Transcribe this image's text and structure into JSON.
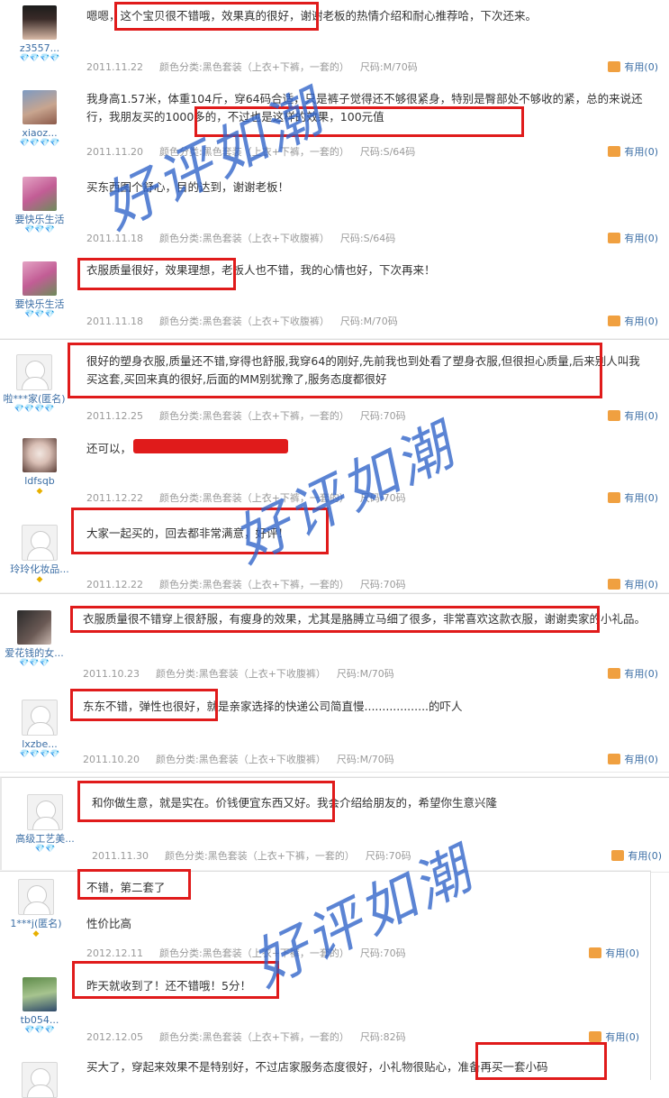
{
  "reviews": [
    {
      "user": "z3557...",
      "rank": "💎💎💎💎",
      "content": "嗯嗯，这个宝贝很不错哦，效果真的很好，谢谢老板的热情介绍和耐心推荐哈，下次还来。",
      "date": "2011.11.22",
      "sku": "颜色分类:黑色套装（上衣+下裤，一套的）",
      "size": "尺码:M/70码",
      "useful": "有用(0)"
    },
    {
      "user": "xiaoz...",
      "rank": "💎💎💎💎",
      "content": "我身高1.57米，体重104斤，穿64码合适，只是裤子觉得还不够很紧身，特别是臀部处不够收的紧，总的来说还行，我朋友买的1000多的，不过也是这样的效果，100元值",
      "date": "2011.11.20",
      "sku": "颜色分类:黑色套装（上衣+下裤，一套的）",
      "size": "尺码:S/64码",
      "useful": "有用(0)"
    },
    {
      "user": "要快乐生活",
      "rank": "💎💎💎",
      "content": "买东西图个舒心，目的达到，谢谢老板！",
      "date": "2011.11.18",
      "sku": "颜色分类:黑色套装（上衣+下收腹裤）",
      "size": "尺码:S/64码",
      "useful": "有用(0)"
    },
    {
      "user": "要快乐生活",
      "rank": "💎💎💎",
      "content": "衣服质量很好，效果理想，老板人也不错，我的心情也好，下次再来！",
      "date": "2011.11.18",
      "sku": "颜色分类:黑色套装（上衣+下收腹裤）",
      "size": "尺码:M/70码",
      "useful": "有用(0)"
    },
    {
      "user": "啦***家(匿名)",
      "rank": "💎💎💎💎",
      "content": "很好的塑身衣服,质量还不错,穿得也舒服,我穿64的刚好,先前我也到处看了塑身衣服,但很担心质量,后来别人叫我买这套,买回来真的很好,后面的MM别犹豫了,服务态度都很好",
      "date": "2011.12.25",
      "sku": "颜色分类:黑色套装（上衣+下裤，一套的）",
      "size": "尺码:70码",
      "useful": "有用(0)"
    },
    {
      "user": "ldfsqb",
      "rank": "◆",
      "content": "还可以，",
      "date": "2011.12.22",
      "sku": "颜色分类:黑色套装（上衣+下裤，一套的）",
      "size": "尺码:70码",
      "useful": "有用(0)"
    },
    {
      "user": "玲玲化妆品...",
      "rank": "◆",
      "content": "大家一起买的，回去都非常满意，好评！",
      "date": "2011.12.22",
      "sku": "颜色分类:黑色套装（上衣+下裤，一套的）",
      "size": "尺码:70码",
      "useful": "有用(0)"
    },
    {
      "user": "爱花钱的女...",
      "rank": "💎💎💎",
      "content": "衣服质量很不错穿上很舒服，有瘦身的效果，尤其是胳膊立马细了很多，非常喜欢这款衣服，谢谢卖家的小礼品。",
      "date": "2011.10.23",
      "sku": "颜色分类:黑色套装（上衣+下收腹裤）",
      "size": "尺码:M/70码",
      "useful": "有用(0)"
    },
    {
      "user": "lxzbe...",
      "rank": "💎💎💎💎",
      "content": "东东不错，弹性也很好，就是亲家选择的快递公司简直慢..................的吓人",
      "date": "2011.10.20",
      "sku": "颜色分类:黑色套装（上衣+下收腹裤）",
      "size": "尺码:M/70码",
      "useful": "有用(0)"
    },
    {
      "user": "高级工艺美...",
      "rank": "💎💎",
      "content": "和你做生意，就是实在。价钱便宜东西又好。我会介绍给朋友的，希望你生意兴隆",
      "date": "2011.11.30",
      "sku": "颜色分类:黑色套装（上衣+下裤，一套的）",
      "size": "尺码:70码",
      "useful": "有用(0)"
    },
    {
      "user": "1***j(匿名)",
      "rank": "◆",
      "content": "不错，第二套了",
      "content2": "性价比高",
      "date": "2012.12.11",
      "sku": "颜色分类:黑色套装（上衣+下裤，一套的）",
      "size": "尺码:70码",
      "useful": "有用(0)"
    },
    {
      "user": "tb054...",
      "rank": "💎💎💎",
      "content": "昨天就收到了！还不错哦！5分！",
      "date": "2012.12.05",
      "sku": "颜色分类:黑色套装（上衣+下裤，一套的）",
      "size": "尺码:82码",
      "useful": "有用(0)"
    },
    {
      "user": "",
      "rank": "",
      "content": "买大了，穿起来效果不是特别好，不过店家服务态度很好，小礼物很贴心，准备再买一套小码"
    }
  ],
  "watermark": "好评如潮",
  "colors": {
    "highlight": "#e01b1b",
    "watermark": "#2e62c9",
    "link": "#3b6ea5"
  }
}
